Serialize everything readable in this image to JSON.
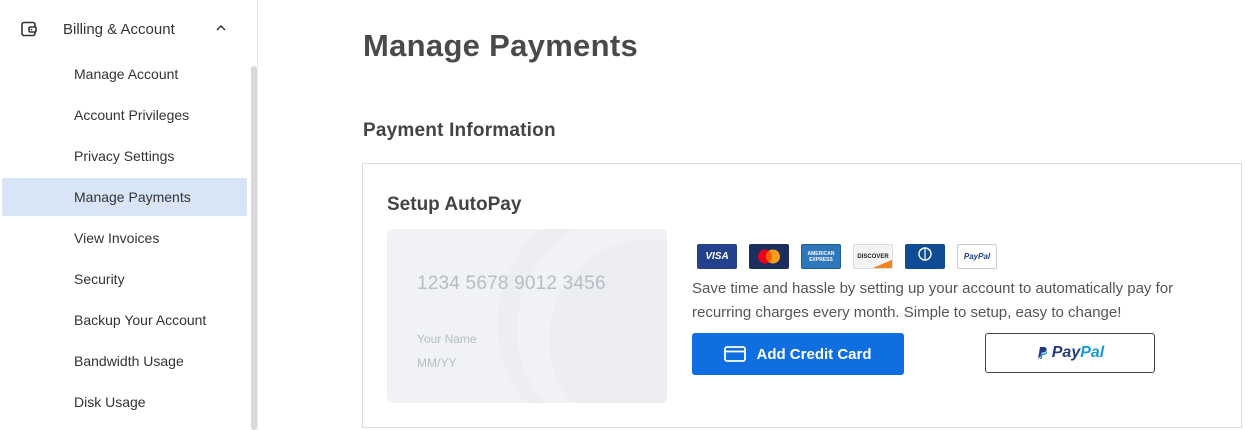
{
  "sidebar": {
    "header_label": "Billing & Account",
    "items": [
      {
        "label": "Manage Account"
      },
      {
        "label": "Account Privileges"
      },
      {
        "label": "Privacy Settings"
      },
      {
        "label": "Manage Payments"
      },
      {
        "label": "View Invoices"
      },
      {
        "label": "Security"
      },
      {
        "label": "Backup Your Account"
      },
      {
        "label": "Bandwidth Usage"
      },
      {
        "label": "Disk Usage"
      }
    ],
    "active_item": "Manage Payments"
  },
  "main": {
    "page_title": "Manage Payments",
    "section_title": "Payment Information",
    "panel": {
      "title": "Setup AutoPay",
      "card": {
        "number_placeholder": "1234 5678 9012 3456",
        "name_placeholder": "Your Name",
        "expiry_placeholder": "MM/YY"
      },
      "logos": {
        "visa": "VISA",
        "mastercard": "MasterCard",
        "amex": "AMERICAN EXPRESS",
        "discover": "DISCOVER",
        "diners": "Diners Club",
        "paypal": "PayPal"
      },
      "description": "Save time and hassle by setting up your account to automatically pay for recurring charges every month. Simple to setup, easy to change!",
      "add_card_button": "Add Credit Card",
      "paypal_button": {
        "pay": "Pay",
        "pal": "Pal"
      }
    }
  },
  "colors": {
    "primary": "#0f6fe0",
    "active_bg": "#d7e5f7",
    "paypal_dark": "#253b80",
    "paypal_light": "#179bd7"
  }
}
